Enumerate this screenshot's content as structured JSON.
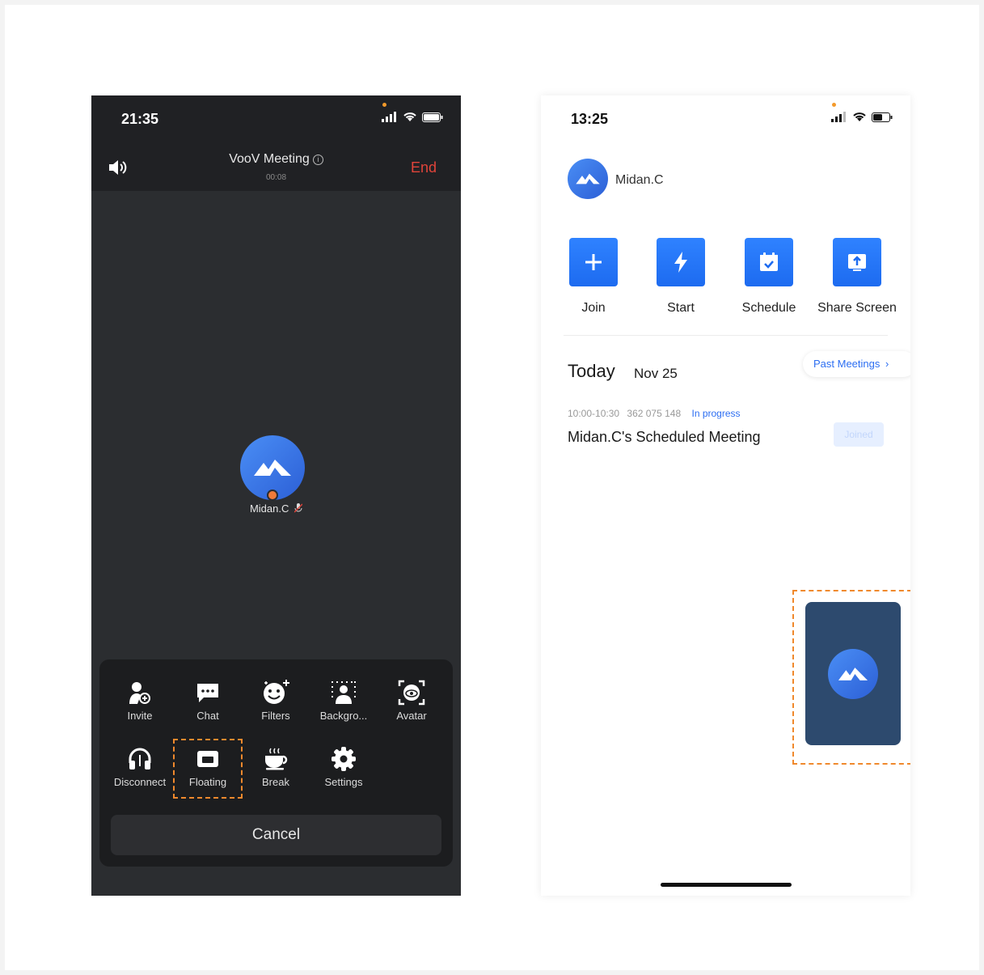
{
  "left_phone": {
    "status_time": "21:35",
    "meeting_title": "VooV Meeting",
    "info_glyph": "i",
    "meeting_duration": "00:08",
    "end_label": "End",
    "participant_name": "Midan.C",
    "toolbar_row1": [
      {
        "label": "Invite",
        "icon": "add-person-icon"
      },
      {
        "label": "Chat",
        "icon": "chat-icon"
      },
      {
        "label": "Filters",
        "icon": "face-filter-icon"
      },
      {
        "label": "Backgro...",
        "icon": "background-icon"
      },
      {
        "label": "Avatar",
        "icon": "avatar-icon"
      }
    ],
    "toolbar_row2": [
      {
        "label": "Disconnect",
        "icon": "headphones-icon"
      },
      {
        "label": "Floating",
        "icon": "floating-window-icon"
      },
      {
        "label": "Break",
        "icon": "coffee-cup-icon"
      },
      {
        "label": "Settings",
        "icon": "gear-icon"
      }
    ],
    "cancel_label": "Cancel"
  },
  "right_phone": {
    "status_time": "13:25",
    "user_name": "Midan.C",
    "actions": [
      {
        "label": "Join",
        "icon": "plus-icon"
      },
      {
        "label": "Start",
        "icon": "lightning-icon"
      },
      {
        "label": "Schedule",
        "icon": "calendar-check-icon"
      },
      {
        "label": "Share Screen",
        "icon": "share-screen-icon"
      }
    ],
    "today_label": "Today",
    "today_date": "Nov 25",
    "past_meetings_label": "Past Meetings",
    "past_meetings_chevron": "›",
    "meeting": {
      "time_range": "10:00-10:30",
      "meeting_id": "362 075 148",
      "status": "In progress",
      "title": "Midan.C's Scheduled Meeting",
      "joined_label": "Joined"
    }
  },
  "colors": {
    "accent_blue": "#2c6ef2",
    "end_red": "#e0443a",
    "highlight_orange": "#f0892d",
    "dark_bg": "#2b2d30"
  }
}
